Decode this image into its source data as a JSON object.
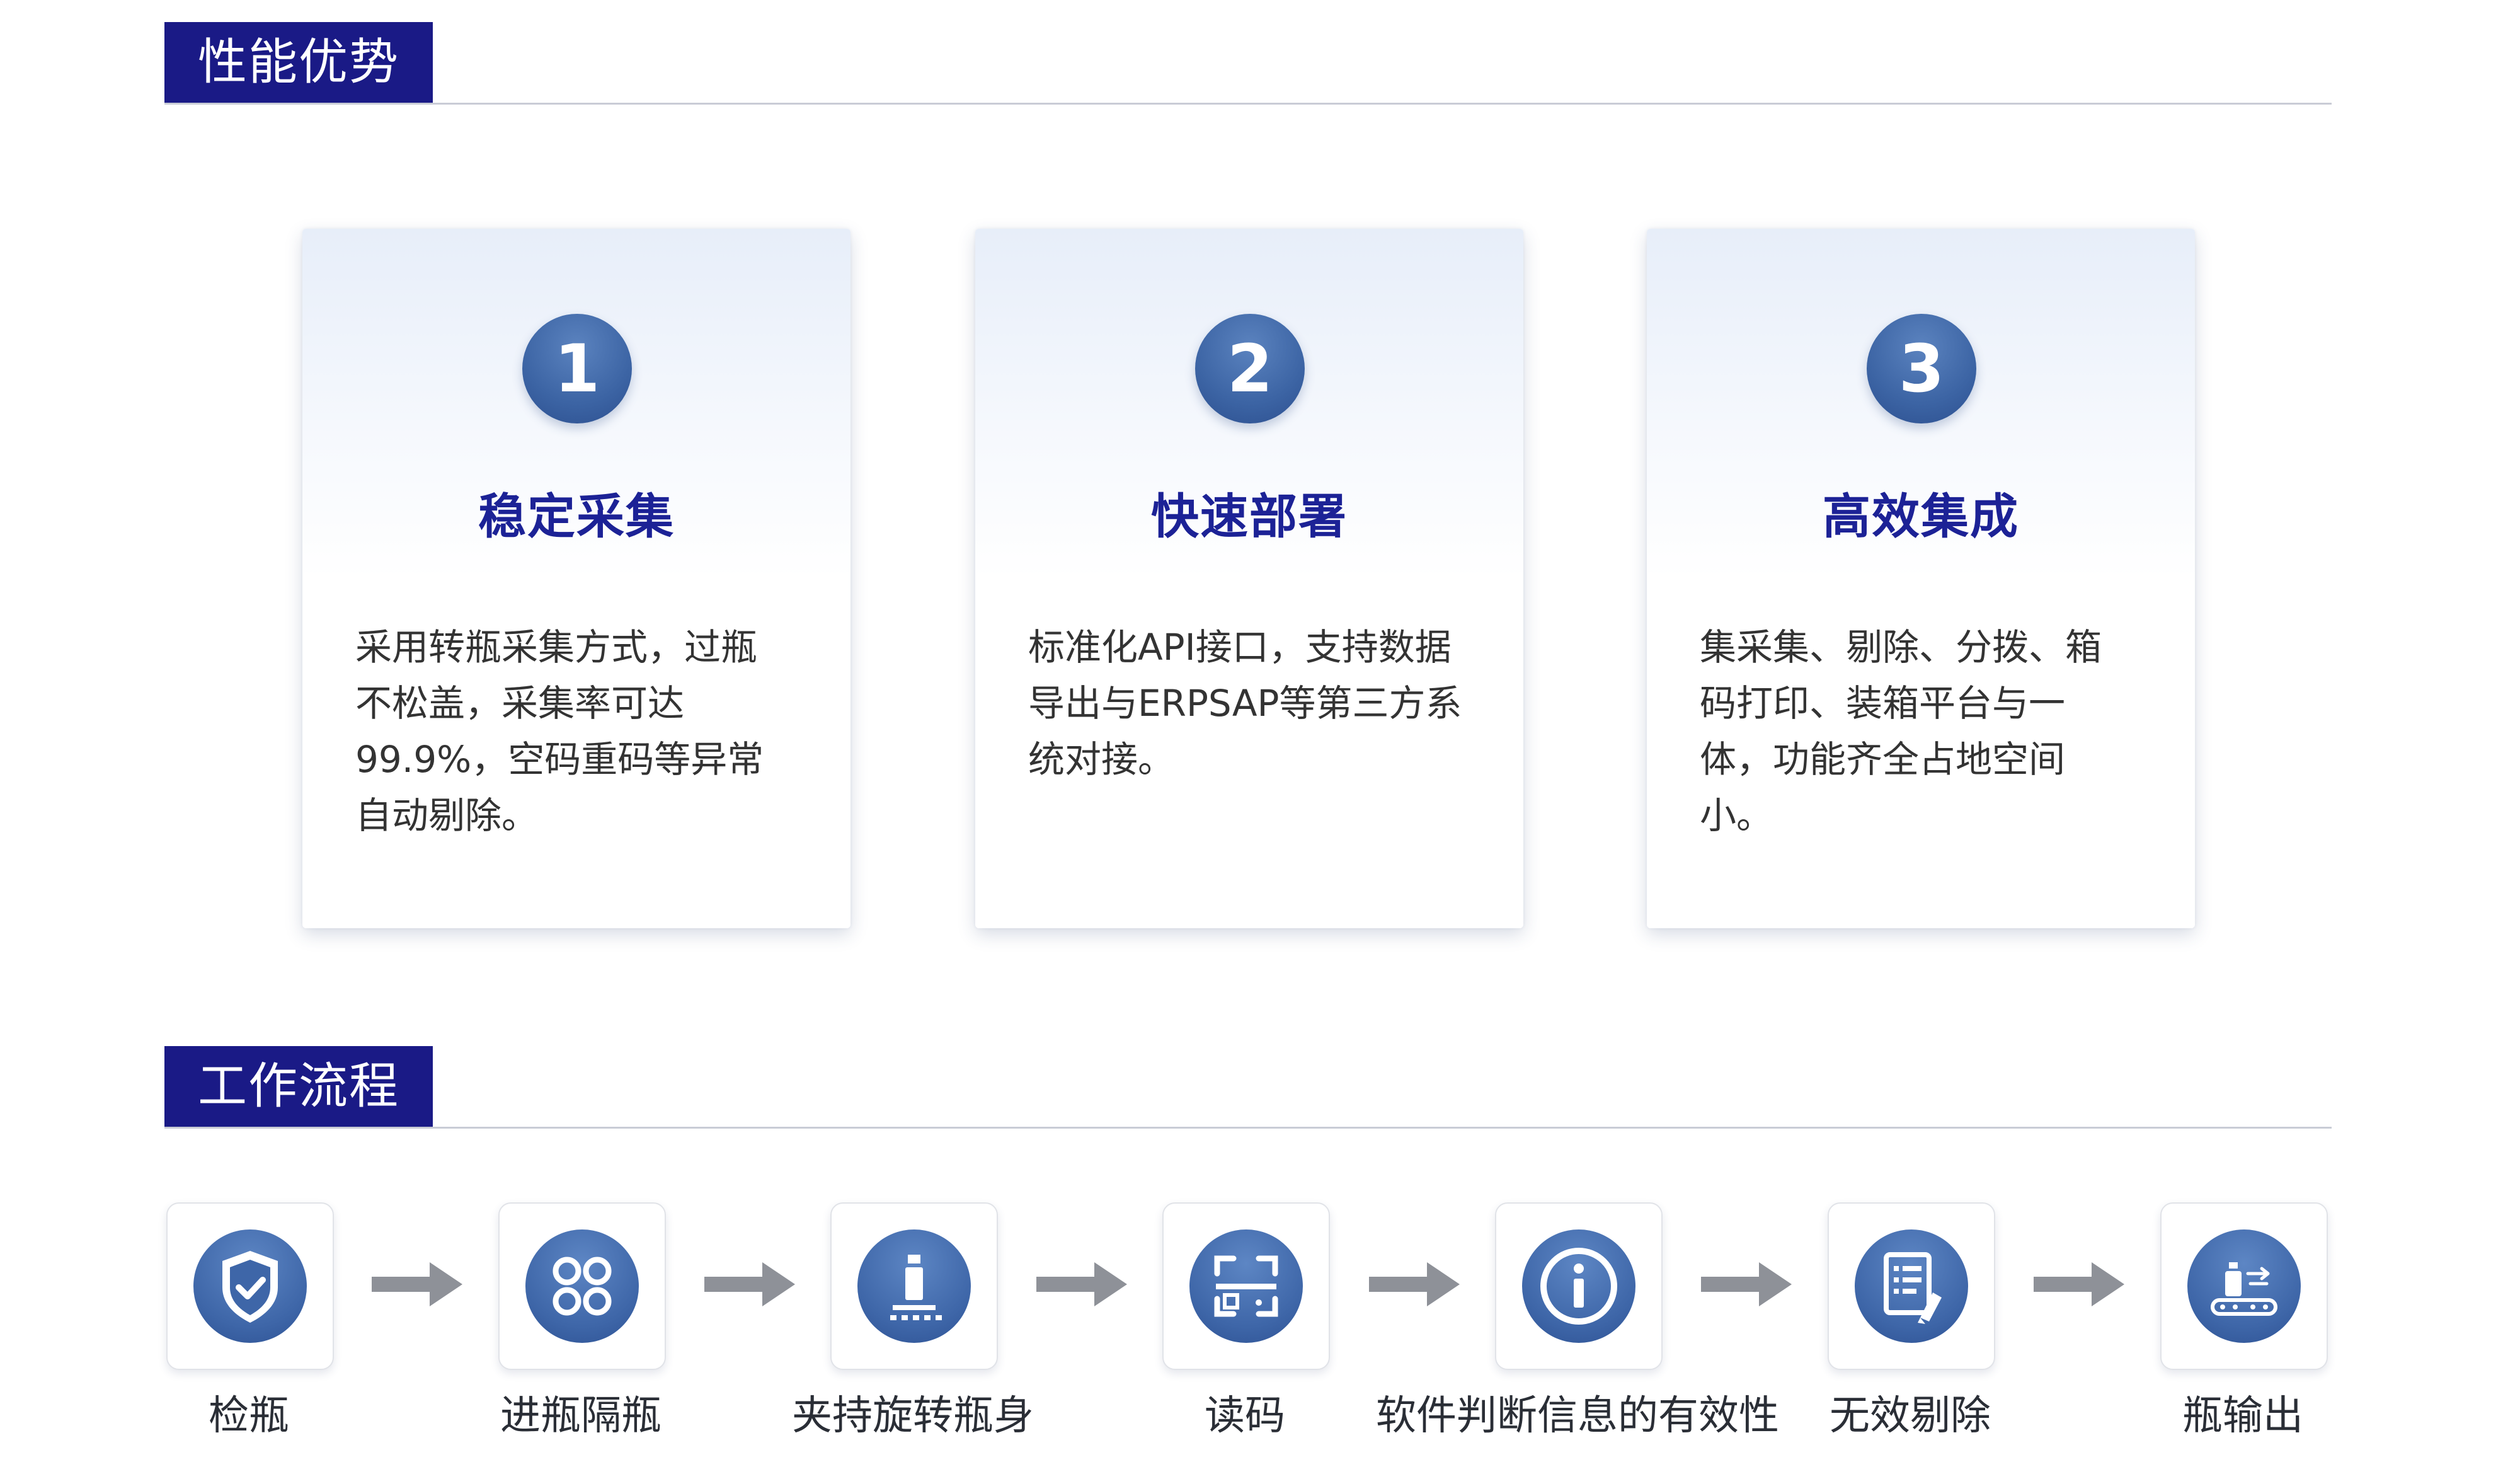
{
  "sections": {
    "performance": "性能优势",
    "workflow": "工作流程"
  },
  "advantages": [
    {
      "number": "1",
      "title": "稳定采集",
      "lines": [
        "采用转瓶采集方式，过瓶",
        "不松盖，采集率可达",
        "99.9%，空码重码等异常",
        "自动剔除。"
      ]
    },
    {
      "number": "2",
      "title": "快速部署",
      "lines": [
        "标准化API接口，支持数据",
        "导出与ERPSAP等第三方系",
        "统对接。"
      ]
    },
    {
      "number": "3",
      "title": "高效集成",
      "lines": [
        "集采集、剔除、分拨、箱",
        "码打印、装箱平台与一",
        "体，功能齐全占地空间",
        "小。"
      ]
    }
  ],
  "steps": [
    {
      "label": "检瓶",
      "icon": "shield-check-icon"
    },
    {
      "label": "进瓶隔瓶",
      "icon": "four-circles-icon"
    },
    {
      "label": "夹持旋转瓶身",
      "icon": "bottle-clamp-icon"
    },
    {
      "label": "读码",
      "icon": "scan-frame-icon"
    },
    {
      "label": "软件判断信息的有效性",
      "icon": "info-icon"
    },
    {
      "label": "无效剔除",
      "icon": "document-remove-icon"
    },
    {
      "label": "瓶输出",
      "icon": "conveyor-output-icon"
    }
  ],
  "colors": {
    "tag_bg": "#1a1a86",
    "title_text": "#1c2296",
    "icon_blue": "#3e66a8",
    "arrow_gray": "#8e9198"
  }
}
